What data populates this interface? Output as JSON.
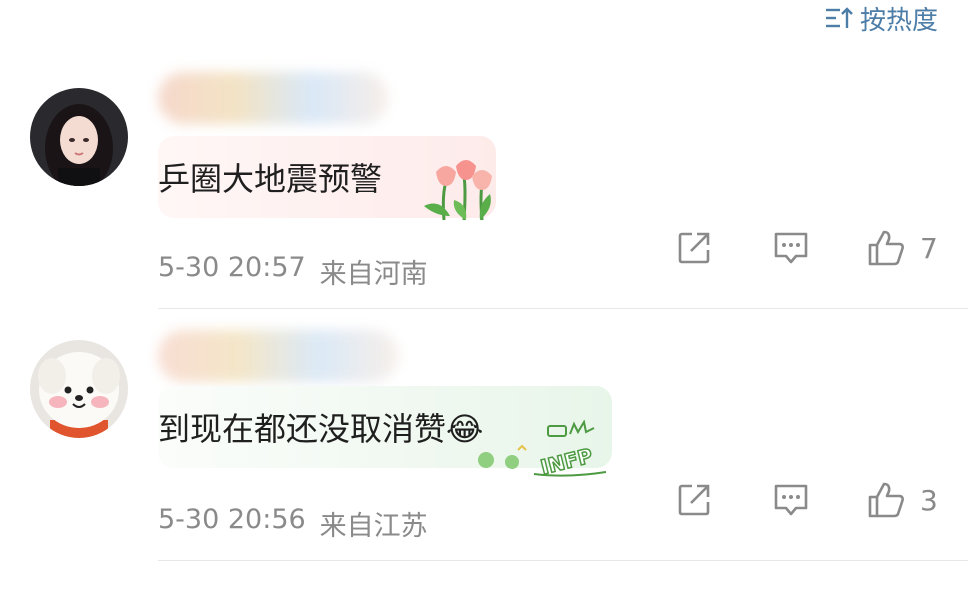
{
  "header": {
    "sort_label": "按热度",
    "sort_icon": "sort-lines-arrow-icon"
  },
  "comments": [
    {
      "text": "乒圈大地震预警",
      "time": "5-30 20:57",
      "location": "来自河南",
      "likes": "7",
      "avatar": "avatar-girl",
      "decoration": "tulips-sticker"
    },
    {
      "text": "到现在都还没取消赞😂",
      "time": "5-30 20:56",
      "location": "来自江苏",
      "likes": "3",
      "avatar": "avatar-plush-dog",
      "decoration": "infp-sticker"
    }
  ],
  "colors": {
    "accent": "#4d7ea8",
    "meta_text": "#8a8a8a",
    "bubble_pink": "#fdeeee",
    "bubble_green": "#eaf6ea"
  },
  "sticker_text": "INFP"
}
